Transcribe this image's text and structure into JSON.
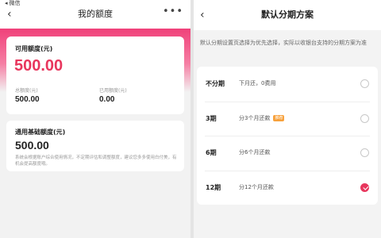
{
  "status": {
    "left_text": "微信"
  },
  "left": {
    "header": {
      "back": "‹",
      "title": "我的额度",
      "more": "•••"
    },
    "available": {
      "label": "可用额度(元)",
      "amount": "500.00"
    },
    "total": {
      "label": "总额度(元)",
      "value": "500.00"
    },
    "used": {
      "label": "已用额度(元)",
      "value": "0.00"
    },
    "basic": {
      "label": "通用基础额度(元)",
      "amount": "500.00",
      "desc": "系统会根据账户综合使用情况，不定期评估和调整额度，建议您多多使用白付美，有机会提高额度哦。"
    }
  },
  "right": {
    "header": {
      "back": "‹",
      "title": "默认分期方案"
    },
    "note": "默认分期设置页选择为优先选择，实际以收银台支持的分期方案为准",
    "options": [
      {
        "term": "不分期",
        "desc": "下月还，0费用",
        "tag": "",
        "selected": false
      },
      {
        "term": "3期",
        "desc": "分3个月还款",
        "tag": "推荐",
        "selected": false
      },
      {
        "term": "6期",
        "desc": "分6个月还款",
        "tag": "",
        "selected": false
      },
      {
        "term": "12期",
        "desc": "分12个月还款",
        "tag": "",
        "selected": true
      }
    ]
  },
  "colors": {
    "accent": "#e8365d",
    "tag": "#f7a13c",
    "gradient_top": "#f0417a"
  }
}
